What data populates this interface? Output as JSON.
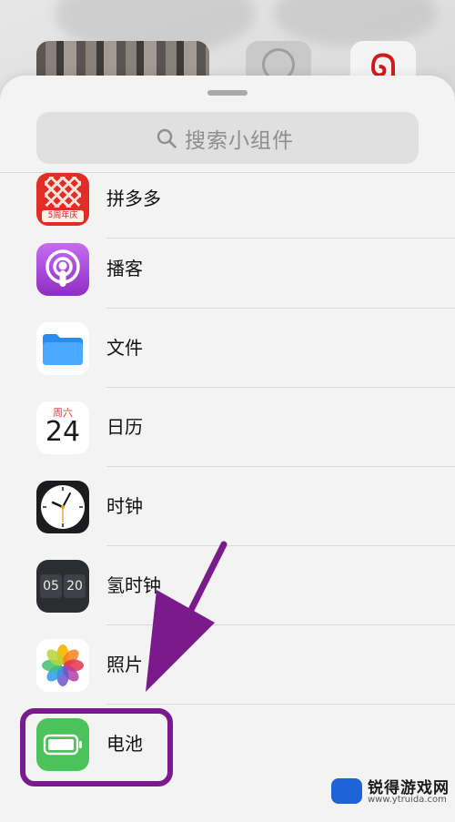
{
  "search": {
    "placeholder": "搜索小组件"
  },
  "widgets": [
    {
      "label": "拼多多",
      "icon": "pinduoduo-icon",
      "badge": "5周年庆"
    },
    {
      "label": "播客",
      "icon": "podcasts-icon"
    },
    {
      "label": "文件",
      "icon": "files-icon"
    },
    {
      "label": "日历",
      "icon": "calendar-icon",
      "weekday": "周六",
      "date": "24"
    },
    {
      "label": "时钟",
      "icon": "clock-icon"
    },
    {
      "label": "氢时钟",
      "icon": "hydrogen-clock-icon",
      "hour": "05",
      "minute": "20"
    },
    {
      "label": "照片",
      "icon": "photos-icon"
    },
    {
      "label": "电池",
      "icon": "battery-icon"
    }
  ],
  "watermark": {
    "name": "锐得游戏网",
    "url": "www.ytruida.com"
  },
  "colors": {
    "annotation": "#7a1a8c",
    "sheet": "#f3f3f3",
    "battery": "#4cc25a"
  }
}
